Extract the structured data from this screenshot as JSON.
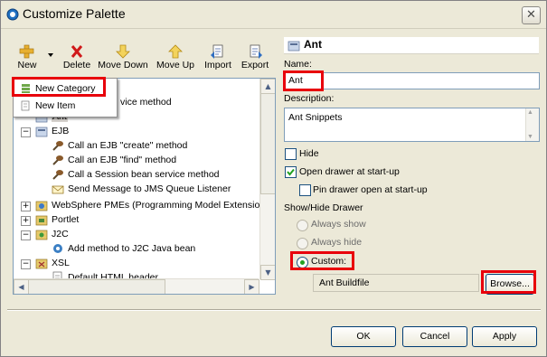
{
  "window": {
    "title": "Customize Palette",
    "close_label": "✕"
  },
  "toolbar": [
    {
      "label": "New",
      "icon": "new-plus-icon"
    },
    {
      "label": "Delete",
      "icon": "delete-x-icon"
    },
    {
      "label": "Move Down",
      "icon": "move-down-arrow-icon"
    },
    {
      "label": "Move Up",
      "icon": "move-up-arrow-icon"
    },
    {
      "label": "Import",
      "icon": "import-icon"
    },
    {
      "label": "Export",
      "icon": "export-icon"
    }
  ],
  "popup_menu": {
    "items": [
      {
        "label": "New Category",
        "icon": "category-drawer-icon"
      },
      {
        "label": "New Item",
        "icon": "item-page-icon"
      }
    ]
  },
  "tree": {
    "rows": [
      {
        "label": "vice method",
        "icon": ""
      },
      {
        "label": "Ant",
        "icon": "ant-folder-icon"
      },
      {
        "label": "EJB",
        "icon": "ejb-folder-icon"
      },
      {
        "label": "Call an EJB \"create\" method",
        "icon": "snippet-bean-icon"
      },
      {
        "label": "Call an EJB \"find\" method",
        "icon": "snippet-bean-icon"
      },
      {
        "label": "Call a Session bean service method",
        "icon": "snippet-bean-icon"
      },
      {
        "label": "Send Message to JMS Queue Listener",
        "icon": "envelope-icon"
      },
      {
        "label": "WebSphere PMEs (Programming Model Extensions",
        "icon": "websphere-folder-icon"
      },
      {
        "label": "Portlet",
        "icon": "portlet-folder-icon"
      },
      {
        "label": "J2C",
        "icon": "j2c-folder-icon"
      },
      {
        "label": "Add method to J2C Java bean",
        "icon": "j2c-method-icon"
      },
      {
        "label": "XSL",
        "icon": "xsl-folder-icon"
      },
      {
        "label": "Default HTML header",
        "icon": "xsl-snippet-icon"
      }
    ]
  },
  "details": {
    "header": "Ant",
    "name_label": "Name:",
    "name_value": "Ant",
    "description_label": "Description:",
    "description_value": "Ant Snippets",
    "hide_label": "Hide",
    "hide_checked": false,
    "open_drawer_label": "Open drawer at start-up",
    "open_drawer_checked": true,
    "pin_drawer_label": "Pin drawer open at start-up",
    "pin_drawer_checked": false,
    "show_hide_group_label": "Show/Hide Drawer",
    "always_show_label": "Always show",
    "always_hide_label": "Always hide",
    "custom_label": "Custom:",
    "selected_radio": "Custom:",
    "custom_value": "Ant Buildfile",
    "browse_label": "Browse..."
  },
  "footer": {
    "ok_label": "OK",
    "cancel_label": "Cancel",
    "apply_label": "Apply"
  },
  "colors": {
    "highlight": "#e8000b",
    "dialog_bg": "#ece9d8",
    "field_border": "#7f9db9"
  }
}
